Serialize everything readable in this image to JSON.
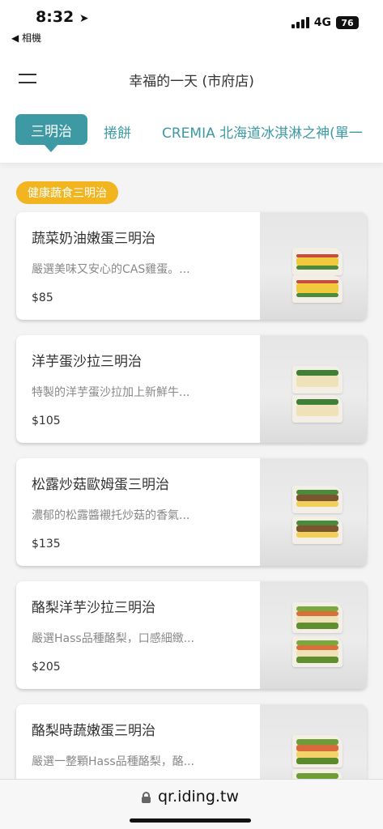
{
  "status_bar": {
    "time": "8:32",
    "back_label": "◀ 相機",
    "network": "4G",
    "battery": "76"
  },
  "header": {
    "title": "幸福的一天 (市府店)"
  },
  "tabs": [
    {
      "label": "三明治",
      "active": true
    },
    {
      "label": "捲餅",
      "active": false
    },
    {
      "label": "CREMIA 北海道冰淇淋之神(單一",
      "active": false
    }
  ],
  "category": {
    "label": "健康蔬食三明治",
    "color": "#f2b520"
  },
  "items": [
    {
      "name": "蔬菜奶油嫩蛋三明治",
      "desc": "嚴選美味又安心的CAS雞蛋。...",
      "price": "$85"
    },
    {
      "name": "洋芋蛋沙拉三明治",
      "desc": "特製的洋芋蛋沙拉加上新鮮牛...",
      "price": "$105"
    },
    {
      "name": "松露炒菇歐姆蛋三明治",
      "desc": "濃郁的松露醬襯托炒菇的香氣...",
      "price": "$135"
    },
    {
      "name": "酪梨洋芋沙拉三明治",
      "desc": "嚴選Hass品種酪梨，口感細緻...",
      "price": "$205"
    },
    {
      "name": "酪梨時蔬嫩蛋三明治",
      "desc": "嚴選一整顆Hass品種酪梨，酪...",
      "price": ""
    }
  ],
  "url_bar": {
    "url": "qr.iding.tw"
  },
  "colors": {
    "accent": "#3d99a3",
    "badge": "#f2b520"
  }
}
